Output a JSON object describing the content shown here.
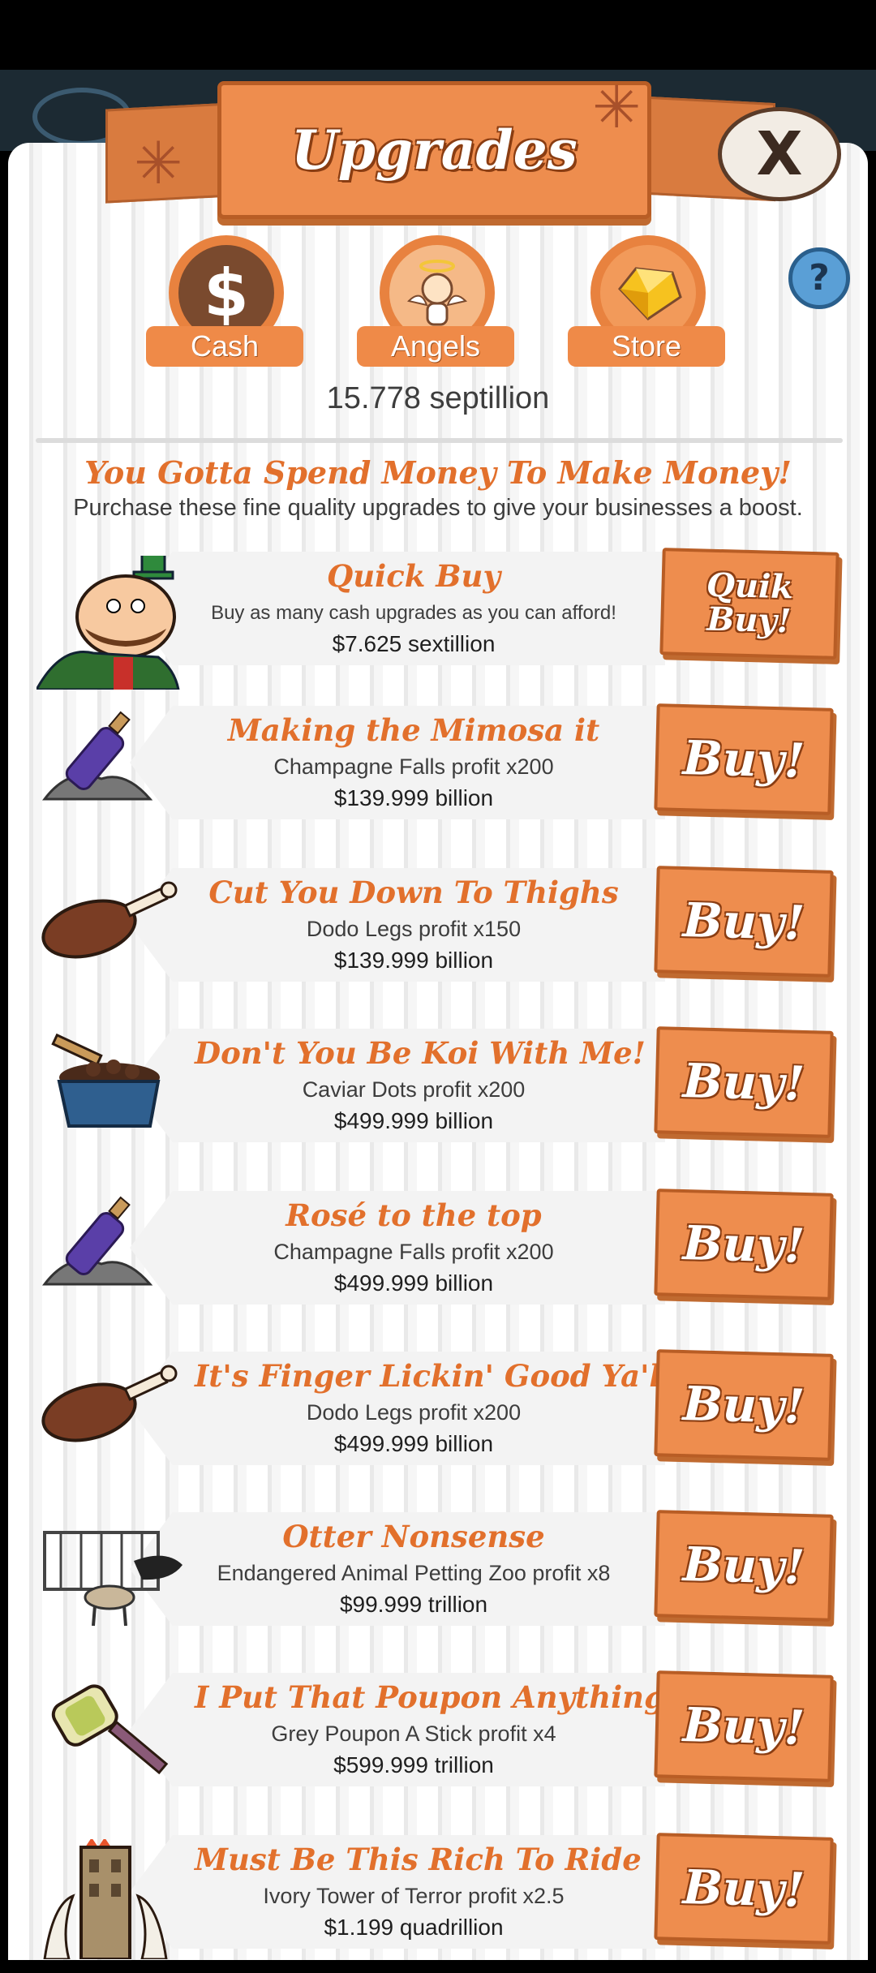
{
  "header": {
    "title": "Upgrades",
    "close_label": "X",
    "help_label": "?"
  },
  "tabs": [
    {
      "label": "Cash",
      "icon": "dollar-icon"
    },
    {
      "label": "Angels",
      "icon": "angel-icon"
    },
    {
      "label": "Store",
      "icon": "gold-gem-icon"
    }
  ],
  "balance": "15.778 septillion",
  "intro": {
    "tagline": "You Gotta Spend Money To Make Money!",
    "subtitle": "Purchase these fine quality upgrades to give your businesses a boost."
  },
  "quick_buy": {
    "name": "Quick Buy",
    "desc": "Buy as many cash upgrades as you can afford!",
    "price": "$7.625 sextillion",
    "button": "Quik Buy!"
  },
  "upgrades": [
    {
      "name": "Making the Mimosa it",
      "desc": "Champagne Falls profit x200",
      "price": "$139.999 billion",
      "button": "Buy!",
      "icon": "champagne-bottle-icon"
    },
    {
      "name": "Cut You Down To Thighs",
      "desc": "Dodo Legs profit x150",
      "price": "$139.999 billion",
      "button": "Buy!",
      "icon": "drumstick-icon"
    },
    {
      "name": "Don't You Be Koi With Me!",
      "desc": "Caviar Dots profit x200",
      "price": "$499.999 billion",
      "button": "Buy!",
      "icon": "caviar-bowl-icon"
    },
    {
      "name": "Rosé to the top",
      "desc": "Champagne Falls profit x200",
      "price": "$499.999 billion",
      "button": "Buy!",
      "icon": "champagne-bottle-icon"
    },
    {
      "name": "It's Finger Lickin' Good Ya'll",
      "desc": "Dodo Legs profit x200",
      "price": "$499.999 billion",
      "button": "Buy!",
      "icon": "drumstick-icon"
    },
    {
      "name": "Otter Nonsense",
      "desc": "Endangered Animal Petting Zoo profit x8",
      "price": "$99.999 trillion",
      "button": "Buy!",
      "icon": "petting-zoo-icon"
    },
    {
      "name": "I Put That Poupon Anything!",
      "desc": "Grey Poupon A Stick profit x4",
      "price": "$599.999 trillion",
      "button": "Buy!",
      "icon": "mustard-stick-icon"
    },
    {
      "name": "Must Be This Rich To Ride",
      "desc": "Ivory Tower of Terror profit x2.5",
      "price": "$1.199 quadrillion",
      "button": "Buy!",
      "icon": "ivory-tower-icon"
    }
  ]
}
